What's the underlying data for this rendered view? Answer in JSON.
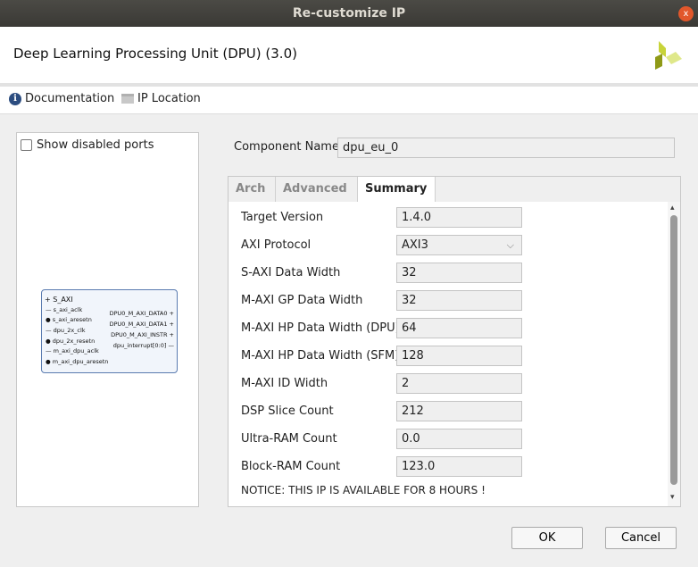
{
  "window": {
    "title": "Re-customize IP",
    "close_label": "x"
  },
  "header": {
    "title": "Deep Learning Processing Unit (DPU) (3.0)"
  },
  "toolbar": {
    "documentation": "Documentation",
    "ip_location": "IP Location"
  },
  "left_panel": {
    "show_disabled_ports": "Show disabled ports",
    "checked": false,
    "block": {
      "left_ports": [
        "S_AXI",
        "s_axi_aclk",
        "s_axi_aresetn",
        "dpu_2x_clk",
        "dpu_2x_resetn",
        "m_axi_dpu_aclk",
        "m_axi_dpu_aresetn"
      ],
      "right_ports": [
        "DPU0_M_AXI_DATA0",
        "DPU0_M_AXI_DATA1",
        "DPU0_M_AXI_INSTR",
        "dpu_interrupt[0:0]"
      ]
    }
  },
  "component_name": {
    "label": "Component Name",
    "value": "dpu_eu_0"
  },
  "tabs": [
    {
      "label": "Arch"
    },
    {
      "label": "Advanced"
    },
    {
      "label": "Summary"
    }
  ],
  "summary": {
    "rows": [
      {
        "label": "Target Version",
        "value": "1.4.0"
      },
      {
        "label": "AXI Protocol",
        "value": "AXI3"
      },
      {
        "label": "S-AXI Data Width",
        "value": "32"
      },
      {
        "label": "M-AXI GP Data Width",
        "value": "32"
      },
      {
        "label": "M-AXI HP Data Width (DPU)",
        "value": "64"
      },
      {
        "label": "M-AXI HP Data Width (SFM)",
        "value": "128"
      },
      {
        "label": "M-AXI ID Width",
        "value": "2"
      },
      {
        "label": "DSP Slice Count",
        "value": "212"
      },
      {
        "label": "Ultra-RAM Count",
        "value": "0.0"
      },
      {
        "label": "Block-RAM Count",
        "value": "123.0"
      }
    ],
    "notice": "NOTICE: THIS IP IS AVAILABLE FOR 8 HOURS !"
  },
  "buttons": {
    "ok": "OK",
    "cancel": "Cancel"
  }
}
